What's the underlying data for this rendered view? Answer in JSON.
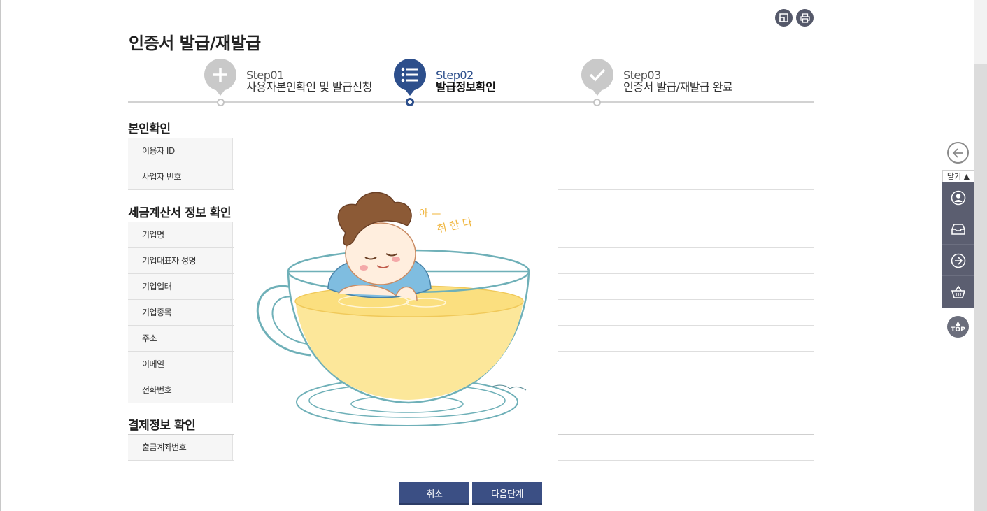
{
  "page": {
    "title": "인증서 발급/재발급"
  },
  "steps": [
    {
      "num": "Step01",
      "label": "사용자본인확인 및 발급신청",
      "icon": "plus-icon",
      "active": false
    },
    {
      "num": "Step02",
      "label": "발급정보확인",
      "icon": "list-icon",
      "active": true
    },
    {
      "num": "Step03",
      "label": "인증서 발급/재발급 완료",
      "icon": "check-icon",
      "active": false
    }
  ],
  "sections": {
    "identity": {
      "title": "본인확인",
      "fields": [
        "이용자 ID",
        "사업자 번호"
      ]
    },
    "tax": {
      "title": "세금계산서 정보 확인",
      "fields": [
        "기업명",
        "기업대표자 성명",
        "기업업태",
        "기업종목",
        "주소",
        "이메일",
        "전화번호"
      ]
    },
    "payment": {
      "title": "결제정보 확인",
      "fields": [
        "출금계좌번호"
      ]
    }
  },
  "illustration": {
    "caption_line1": "아 —",
    "caption_line2": "취 한 다"
  },
  "buttons": {
    "cancel": "취소",
    "next": "다음단계"
  },
  "quick_menu": {
    "close_label": "닫기 ▲",
    "top_label": "TOP",
    "items": [
      "user-icon",
      "inbox-icon",
      "arrow-right-icon",
      "basket-icon"
    ]
  },
  "colors": {
    "accent": "#2d4f8c",
    "button": "#3b4f84",
    "quick_panel": "#5b5e70",
    "inactive_step": "#c9c9c9"
  }
}
